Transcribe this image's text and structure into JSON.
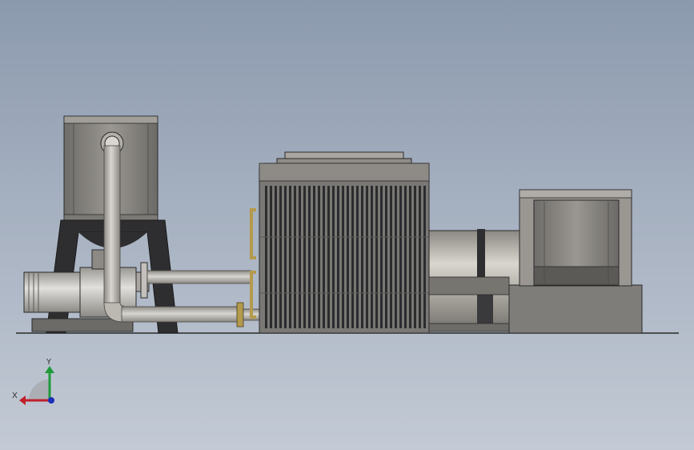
{
  "viewport": {
    "background_top": "#8c9aae",
    "background_bottom": "#c3cad5"
  },
  "model": {
    "components": [
      {
        "name": "elevated-water-tank",
        "icon": "tank-icon"
      },
      {
        "name": "centrifugal-pump",
        "icon": "pump-icon"
      },
      {
        "name": "heat-exchanger",
        "icon": "radiator-icon"
      },
      {
        "name": "cylindrical-vessel",
        "icon": "cylinder-icon"
      },
      {
        "name": "cabinet-unit",
        "icon": "cabinet-icon"
      }
    ],
    "colors": {
      "steel": "#8f8c86",
      "steel_dark": "#5a5854",
      "frame": "#2e2e30",
      "pipe": "#b9b6b0",
      "fin": "#2b2c2e",
      "brass": "#b49a4c"
    }
  },
  "triad": {
    "x_label": "X",
    "y_label": "Y",
    "x_color": "#c0202a",
    "y_color": "#1f9a3a",
    "z_color": "#1d2fb8"
  }
}
